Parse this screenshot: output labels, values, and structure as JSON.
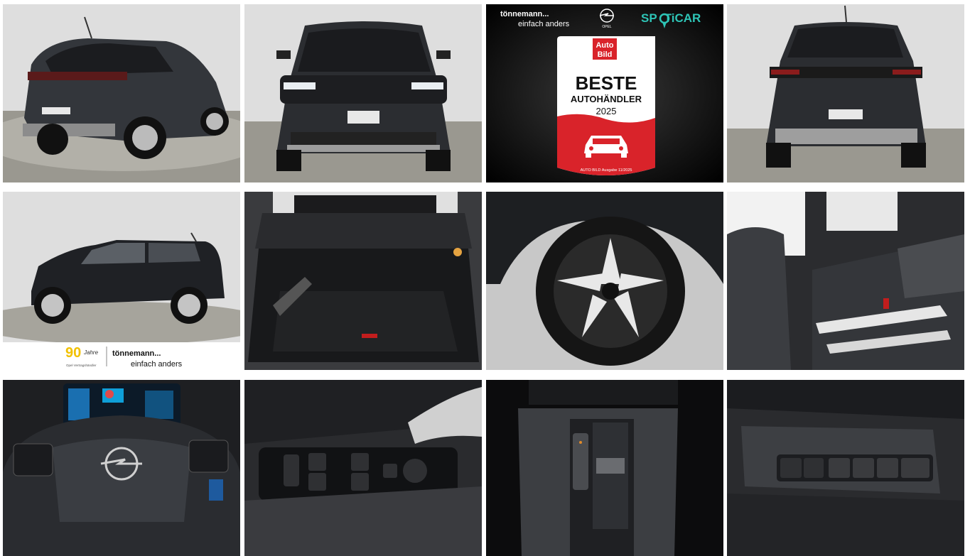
{
  "gallery": {
    "photos": [
      {
        "id": "rear-three-quarter-view",
        "alt": "Rear three-quarter view"
      },
      {
        "id": "front-view",
        "alt": "Front view"
      },
      {
        "id": "award-banner",
        "alt": "Award banner"
      },
      {
        "id": "rear-view",
        "alt": "Rear view"
      },
      {
        "id": "side-view",
        "alt": "Side view"
      },
      {
        "id": "trunk-view",
        "alt": "Trunk"
      },
      {
        "id": "wheel-view",
        "alt": "Wheel"
      },
      {
        "id": "rear-seats-view",
        "alt": "Rear seats"
      },
      {
        "id": "steering-wheel-view",
        "alt": "Steering wheel"
      },
      {
        "id": "door-switches-view",
        "alt": "Door switches"
      },
      {
        "id": "center-console-view",
        "alt": "Center console"
      },
      {
        "id": "dashboard-buttons-view",
        "alt": "Dashboard buttons"
      }
    ]
  },
  "award": {
    "dealer_name": "tönnemann...",
    "dealer_slogan": "einfach anders",
    "opel_label": "OPEL",
    "spoticar_part1": "SP",
    "spoticar_part2": "TiCAR",
    "autobild_line1": "Auto",
    "autobild_line2": "Bild",
    "beste": "BESTE",
    "autohaendler": "AUTOHÄNDLER",
    "year": "2025",
    "source": "AUTO BILD Ausgabe 11/2025"
  },
  "side_banner": {
    "years_number": "90",
    "years_word": "Jahre",
    "partner_text": "Opel Vertragshändler",
    "dealer_name": "tönnemann...",
    "dealer_slogan": "einfach anders"
  },
  "plate": {
    "text": "SPOTiCAR"
  },
  "colors": {
    "award_red": "#d9232a",
    "spoticar_teal": "#2ec4b6",
    "car_body": "#2a2c30",
    "badge_yellow": "#f2c100"
  }
}
